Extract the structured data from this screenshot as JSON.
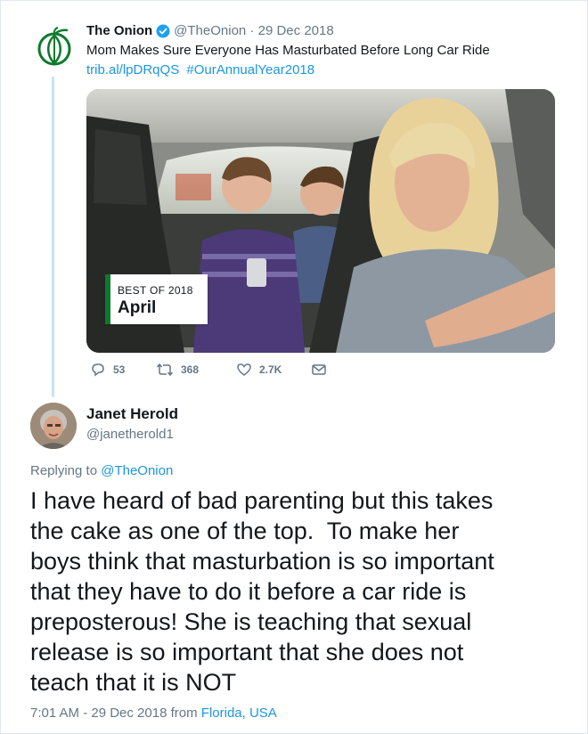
{
  "quoted_tweet": {
    "author_name": "The Onion",
    "verified": true,
    "handle": "@TheOnion",
    "date": "29 Dec 2018",
    "text": "Mom Makes Sure Everyone Has Masturbated Before Long Car Ride",
    "link": "trib.al/lpDRqQS",
    "hashtag": "#OurAnnualYear2018",
    "image_badge": {
      "label": "BEST OF 2018",
      "month": "April"
    },
    "actions": {
      "replies": "53",
      "retweets": "368",
      "likes": "2.7K"
    },
    "icons": [
      "onion-logo",
      "verified-badge-icon",
      "reply-icon",
      "retweet-icon",
      "like-icon",
      "dm-icon"
    ]
  },
  "reply_tweet": {
    "author_name": "Janet Herold",
    "handle": "@janetherold1",
    "replying_to_label": "Replying to",
    "replying_to_handle": "@TheOnion",
    "text_lines": [
      "I have heard of bad parenting but this takes",
      "the cake as one of the top.  To make her",
      "boys think that masturbation is so important",
      "that they have to do it before a car ride is",
      "preposterous! She is teaching that sexual",
      "release is so important that she does not",
      "teach that it is NOT"
    ],
    "timestamp": "7:01 AM - 29 Dec 2018 from",
    "location": "Florida, USA"
  },
  "colors": {
    "link": "#1b95e0",
    "muted": "#657786",
    "text": "#14171a",
    "thread_line": "#c4e4f7",
    "onion_green": "#0d7a2c"
  }
}
